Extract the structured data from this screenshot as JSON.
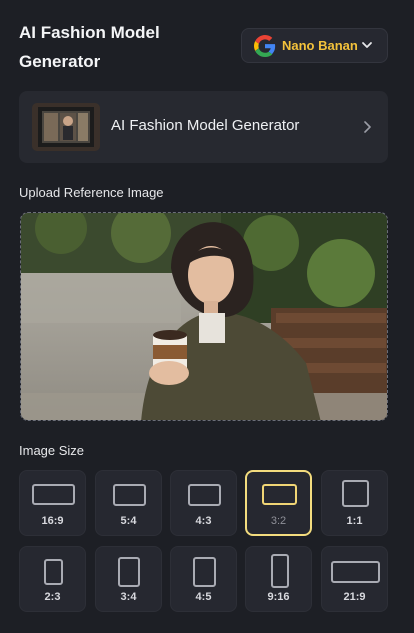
{
  "header": {
    "title_line1": "AI Fashion Model",
    "title_line2": "Generator"
  },
  "model_select": {
    "value": "Nano Banana",
    "icon": "google-g-icon",
    "accent": "#f3c23b"
  },
  "tool_card": {
    "name": "AI Fashion Model Generator",
    "icon": "chevron-right-icon"
  },
  "upload": {
    "label": "Upload Reference Image"
  },
  "image_size": {
    "label": "Image Size",
    "selected": "3:2",
    "options": [
      {
        "ratio": "16:9"
      },
      {
        "ratio": "5:4"
      },
      {
        "ratio": "4:3"
      },
      {
        "ratio": "3:2"
      },
      {
        "ratio": "1:1"
      },
      {
        "ratio": "2:3"
      },
      {
        "ratio": "3:4"
      },
      {
        "ratio": "4:5"
      },
      {
        "ratio": "9:16"
      },
      {
        "ratio": "21:9"
      }
    ]
  },
  "colors": {
    "background": "#1d1f25",
    "card": "#262830",
    "selected_border": "#f3dc7e"
  }
}
